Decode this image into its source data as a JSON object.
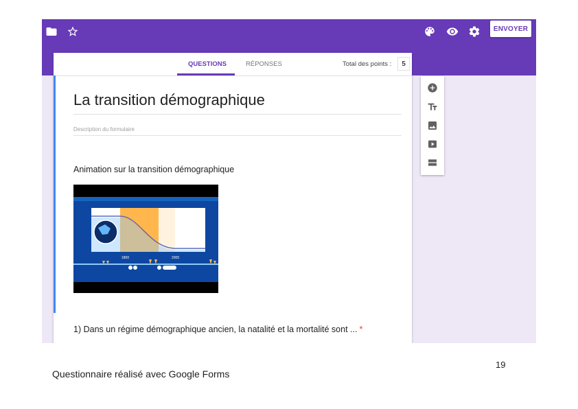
{
  "header": {
    "send_label": "ENVOYER",
    "left_icons": [
      "folder-icon",
      "star-icon"
    ],
    "right_icons": [
      "palette-icon",
      "eye-icon",
      "gear-icon"
    ],
    "accent_color": "#673ab7"
  },
  "tabs": {
    "questions": "QUESTIONS",
    "responses": "RÉPONSES",
    "active": "QUESTIONS"
  },
  "points": {
    "label": "Total des points :",
    "value": "5"
  },
  "form": {
    "title": "La transition démographique",
    "description_placeholder": "Description du formulaire",
    "video_title": "Animation sur la transition démographique",
    "video_axis_labels": [
      "1800",
      "2005"
    ],
    "question_1": "1) Dans un régime démographique ancien, la natalité et la mortalité sont ...",
    "required_marker": "*"
  },
  "side_toolbar": {
    "icons": [
      "add-question-icon",
      "title-text-icon",
      "image-icon",
      "video-icon",
      "section-icon"
    ]
  },
  "slide": {
    "caption": "Questionnaire réalisé avec Google Forms",
    "page_number": "19"
  }
}
